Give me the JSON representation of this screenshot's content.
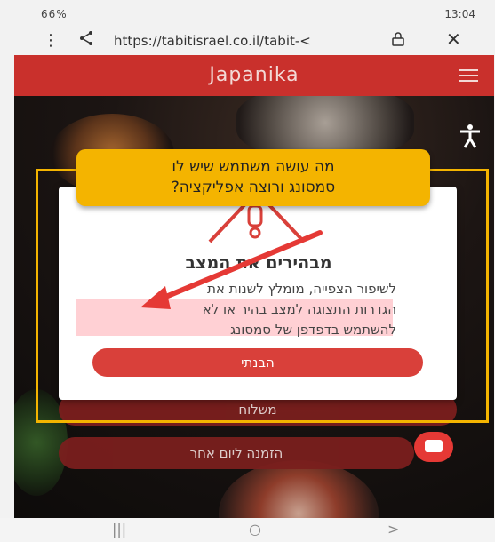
{
  "status_bar": {
    "left": "66% ",
    "time": "13:04"
  },
  "browser": {
    "url": "https://tabitisrael.co.il/tabit-<"
  },
  "site": {
    "brand": "Japanika"
  },
  "dialog": {
    "title": "מבהירים את המצב",
    "body_line1": "לשיפור הצפייה, מומלץ לשנות את",
    "body_line2": "הגדרות התצוגה למצב בהיר או לא",
    "body_line3": "להשתמש בדפדפן של סמסונג",
    "ok_button": "הבנתי"
  },
  "page_buttons": {
    "delivery": "משלוח",
    "order_other_day": "הזמנה ליום אחר"
  },
  "annotation": {
    "line1": "מה עושה משתמש שיש לו",
    "line2": "סמסונג ורוצה אפליקציה?"
  },
  "colors": {
    "brand_red": "#c9302c",
    "annotation_yellow": "#f4b400",
    "arrow_red": "#e53935"
  },
  "icons": [
    "share-icon",
    "lock-icon",
    "close-icon",
    "hamburger-menu-icon",
    "accessibility-icon",
    "warning-icon",
    "chat-icon",
    "recents-icon",
    "home-icon",
    "back-icon"
  ]
}
